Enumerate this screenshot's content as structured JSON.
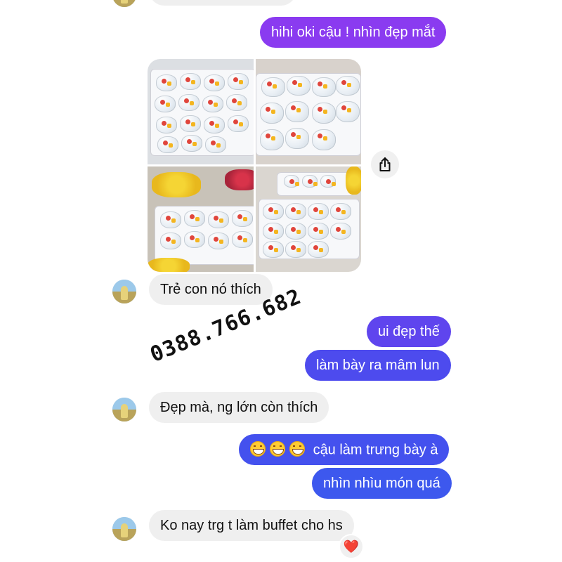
{
  "conversation": {
    "messages": [
      {
        "id": "m1",
        "side": "out",
        "text": "hihi oki cậu ! nhìn đẹp mắt"
      },
      {
        "id": "m2",
        "side": "in",
        "text": "Trẻ con nó thích"
      },
      {
        "id": "m3",
        "side": "out",
        "text": "ui đẹp thế"
      },
      {
        "id": "m4",
        "side": "out",
        "text": "làm bày ra mâm lun"
      },
      {
        "id": "m5",
        "side": "in",
        "text": "Đẹp mà, ng lớn còn thích"
      },
      {
        "id": "m6",
        "side": "out",
        "text": "cậu làm trưng bày à",
        "emojis": [
          "grinning-face",
          "grinning-face",
          "grinning-face"
        ]
      },
      {
        "id": "m7",
        "side": "out",
        "text": "nhìn nhìu món quá"
      },
      {
        "id": "m8",
        "side": "in",
        "text": "Ko nay trg t làm buffet cho hs",
        "reaction": "❤️"
      }
    ],
    "photo_album": {
      "count": 4,
      "description_icon": "share-icon"
    }
  },
  "watermark": {
    "text": "0388.766.682"
  },
  "colors": {
    "incoming_bubble": "#efefef",
    "outgoing_purple": "#8a3bf0",
    "outgoing_blue": "#3a5cee",
    "reaction_heart": "#e0282e"
  }
}
